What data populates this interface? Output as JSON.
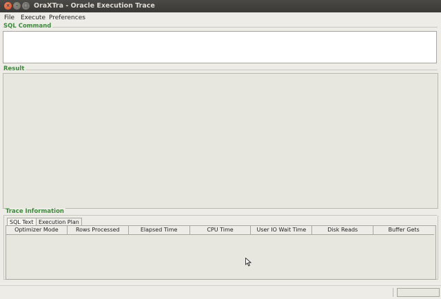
{
  "window": {
    "title": "OraXTra - Oracle Execution Trace",
    "controls": {
      "close": "×",
      "minimize": "–",
      "maximize": "□"
    }
  },
  "menu": {
    "items": [
      {
        "label": "File"
      },
      {
        "label": "Execute"
      },
      {
        "label": "Preferences"
      }
    ]
  },
  "sql_command": {
    "label": "SQL Command",
    "value": ""
  },
  "result": {
    "label": "Result"
  },
  "trace": {
    "label": "Trace Information",
    "tabs": [
      {
        "label": "SQL Text",
        "active": true
      },
      {
        "label": "Execution Plan",
        "active": false
      }
    ],
    "columns": [
      "Optimizer Mode",
      "Rows Processed",
      "Elapsed Time",
      "CPU Time",
      "User IO Wait Time",
      "Disk Reads",
      "Buffer Gets"
    ]
  },
  "colors": {
    "accent_label": "#3d8a3d",
    "titlebar": "#3f3e3a",
    "close_button": "#e0542a"
  }
}
